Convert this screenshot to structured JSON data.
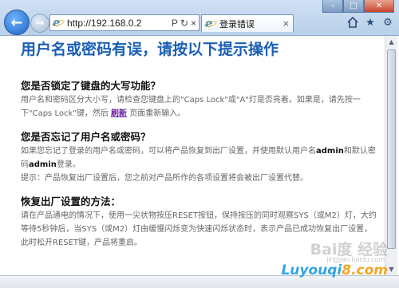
{
  "browser": {
    "address_url": "http://192.168.0.2",
    "search_glyph": "Ρ",
    "refresh_glyph": "↻",
    "close_glyph": "×",
    "tab_title": "登录错误",
    "window_controls": [
      "–",
      "□",
      "✕"
    ],
    "back_icon": "back-arrow-icon",
    "forward_icon": "forward-arrow-icon",
    "accent_color": "#1a5fb4"
  },
  "page": {
    "title": "用户名或密码有误，请按以下提示操作",
    "sections": [
      {
        "heading": "您是否锁定了键盘的大写功能？",
        "text_before_link": "用户名和密码区分大小写，请检查您键盘上的\"Caps Lock\"或\"A\"灯是否亮着。如果是，请先按一下\"Caps Lock\"键，然后 ",
        "link": "刷新",
        "text_after_link": " 页面重新输入。"
      },
      {
        "heading": "您是否忘记了用户名或密码？",
        "p1_a": "如果您忘记了登录的用户名或密码，可以将产品恢复到出厂设置，并使用默认用户名",
        "p1_b1": "admin",
        "p1_c": "和默认密码",
        "p1_b2": "admin",
        "p1_d": "登录。",
        "p2": "提示：产品恢复出厂设置后，您之前对产品所作的各项设置将会被出厂设置代替。"
      },
      {
        "heading": "恢复出厂设置的方法：",
        "text": "请在产品通电的情况下，使用一尖状物按压RESET按钮，保持按压的同时观察SYS（或M2）灯，大约等待5秒钟后，当SYS（或M2）灯由缓慢闪烁变为快速闪烁状态时，表示产品已成功恢复出厂设置，此时松开RESET键，产品将重启。"
      }
    ]
  },
  "watermark": {
    "main": "Bai度 经验",
    "sub": "jingyan.baidu.com",
    "site_a": "Luyouqi",
    "site_b": "8.com"
  }
}
